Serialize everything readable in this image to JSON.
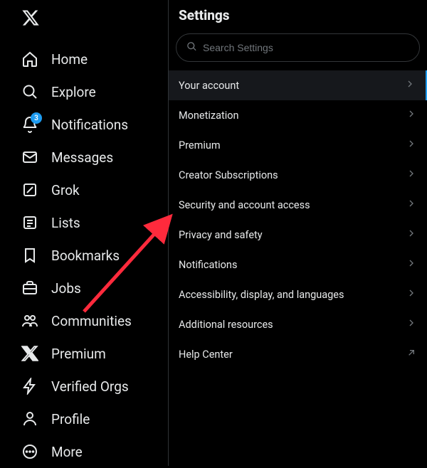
{
  "sidebar": {
    "items": [
      {
        "key": "home",
        "label": "Home"
      },
      {
        "key": "explore",
        "label": "Explore"
      },
      {
        "key": "notifications",
        "label": "Notifications",
        "badge": "3"
      },
      {
        "key": "messages",
        "label": "Messages"
      },
      {
        "key": "grok",
        "label": "Grok"
      },
      {
        "key": "lists",
        "label": "Lists"
      },
      {
        "key": "bookmarks",
        "label": "Bookmarks"
      },
      {
        "key": "jobs",
        "label": "Jobs"
      },
      {
        "key": "communities",
        "label": "Communities"
      },
      {
        "key": "premium",
        "label": "Premium"
      },
      {
        "key": "verified-orgs",
        "label": "Verified Orgs"
      },
      {
        "key": "profile",
        "label": "Profile"
      },
      {
        "key": "more",
        "label": "More"
      }
    ]
  },
  "settings": {
    "title": "Settings",
    "search_placeholder": "Search Settings",
    "items": [
      {
        "key": "your-account",
        "label": "Your account",
        "active": true
      },
      {
        "key": "monetization",
        "label": "Monetization"
      },
      {
        "key": "premium",
        "label": "Premium"
      },
      {
        "key": "creator-subscriptions",
        "label": "Creator Subscriptions"
      },
      {
        "key": "security-access",
        "label": "Security and account access"
      },
      {
        "key": "privacy-safety",
        "label": "Privacy and safety"
      },
      {
        "key": "notifications",
        "label": "Notifications"
      },
      {
        "key": "accessibility",
        "label": "Accessibility, display, and languages"
      },
      {
        "key": "additional-resources",
        "label": "Additional resources"
      },
      {
        "key": "help-center",
        "label": "Help Center",
        "external": true
      }
    ]
  }
}
